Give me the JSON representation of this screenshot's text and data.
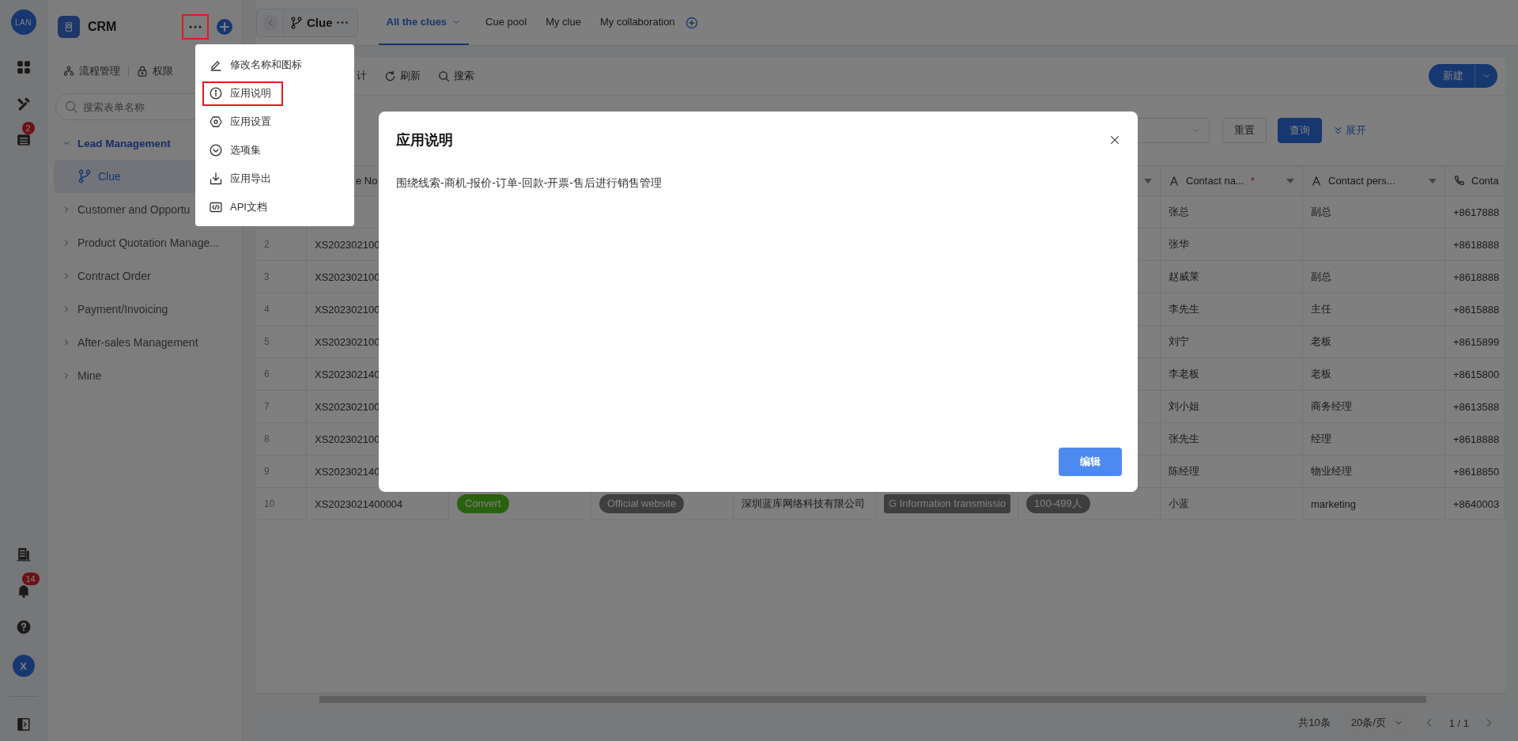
{
  "rail": {
    "logo": "LAN",
    "top": [
      {
        "kind": "grid"
      },
      {
        "kind": "tools"
      },
      {
        "kind": "list",
        "badge": "2"
      }
    ],
    "bottom": [
      {
        "kind": "book"
      },
      {
        "kind": "bell",
        "badge": "14"
      },
      {
        "kind": "help"
      }
    ],
    "avatar": "X"
  },
  "sidebar": {
    "title": "CRM",
    "more_highlighted": true,
    "tabs": [
      {
        "label": "流程管理",
        "kind": "flow"
      },
      {
        "label": "权限",
        "kind": "lock"
      }
    ],
    "search": {
      "placeholder": "搜索表单名称"
    },
    "tree": [
      {
        "label": "Lead Management",
        "expanded": true,
        "children": [
          {
            "label": "Clue",
            "selected": true
          }
        ]
      },
      {
        "label": "Customer and Opportu",
        "expanded": false
      },
      {
        "label": "Product Quotation Manage...",
        "expanded": false
      },
      {
        "label": "Contract Order",
        "expanded": false
      },
      {
        "label": "Payment/Invoicing",
        "expanded": false
      },
      {
        "label": "After-sales Management",
        "expanded": false
      },
      {
        "label": "Mine",
        "expanded": false
      }
    ]
  },
  "header": {
    "title": "Clue",
    "tabs": [
      {
        "label": "All the clues",
        "selected": true,
        "dropdown": true
      },
      {
        "label": "Cue pool",
        "selected": false,
        "dropdown": false
      },
      {
        "label": "My clue",
        "selected": false,
        "dropdown": false
      },
      {
        "label": "My collaboration",
        "selected": false,
        "dropdown": false
      }
    ]
  },
  "toolbar": {
    "actions": [
      {
        "label": "计",
        "kind": "plain"
      },
      {
        "label": "刷新",
        "kind": "refresh"
      },
      {
        "label": "搜索",
        "kind": "search"
      }
    ],
    "new_button": "新建"
  },
  "filters": {
    "reset": "重置",
    "query": "查询",
    "expand": "展开"
  },
  "table": {
    "header": {
      "id": "e No",
      "contact_name": {
        "label": "Contact na...",
        "mark": "*"
      },
      "contact_person": "Contact pers...",
      "phone": "Conta"
    },
    "rows": [
      {
        "contact_name": "张总",
        "contact_person": "副总",
        "phone": "+8617888"
      },
      {
        "number": "2",
        "id": "XS202302100",
        "contact_name": "张华",
        "phone": "+8618888"
      },
      {
        "number": "3",
        "id": "XS202302100",
        "contact_name": "赵威莱",
        "contact_person": "副总",
        "phone": "+8618888"
      },
      {
        "number": "4",
        "id": "XS202302100",
        "contact_name": "李先生",
        "contact_person": "主任",
        "phone": "+8615888"
      },
      {
        "number": "5",
        "id": "XS202302100",
        "contact_name": "刘宁",
        "contact_person": "老板",
        "phone": "+8615899"
      },
      {
        "number": "6",
        "id": "XS202302140",
        "contact_name": "李老板",
        "contact_person": "老板",
        "phone": "+8615800"
      },
      {
        "number": "7",
        "id": "XS202302100",
        "contact_name": "刘小姐",
        "contact_person": "商务经理",
        "phone": "+8613588"
      },
      {
        "number": "8",
        "id": "XS202302100",
        "contact_name": "张先生",
        "contact_person": "经理",
        "phone": "+8618888"
      },
      {
        "number": "9",
        "id": "XS202302140",
        "contact_name": "陈经理",
        "contact_person": "物业经理",
        "phone": "+8618850"
      },
      {
        "number": "10",
        "id": "XS2023021400004",
        "status": "Convert",
        "source": "Official website",
        "company": "深圳蓝库网络科技有限公司",
        "industry": "G Information transmissio",
        "size": "100-499人",
        "contact_name": "小蓝",
        "contact_person": "marketing",
        "phone": "+8640003"
      }
    ]
  },
  "pagination": {
    "total": "共10条",
    "page_size": "20条/页",
    "page": "1 / 1"
  },
  "menu": [
    {
      "label": "修改名称和图标",
      "kind": "edit",
      "highlighted": false
    },
    {
      "label": "应用说明",
      "kind": "info",
      "highlighted": true
    },
    {
      "label": "应用设置",
      "kind": "settings",
      "highlighted": false
    },
    {
      "label": "选项集",
      "kind": "options",
      "highlighted": false
    },
    {
      "label": "应用导出",
      "kind": "export",
      "highlighted": false
    },
    {
      "label": "API文档",
      "kind": "api",
      "highlighted": false
    }
  ],
  "modal": {
    "title": "应用说明",
    "body": "围绕线索-商机-报价-订单-回款-开票-售后进行销售管理",
    "button": "编辑"
  }
}
